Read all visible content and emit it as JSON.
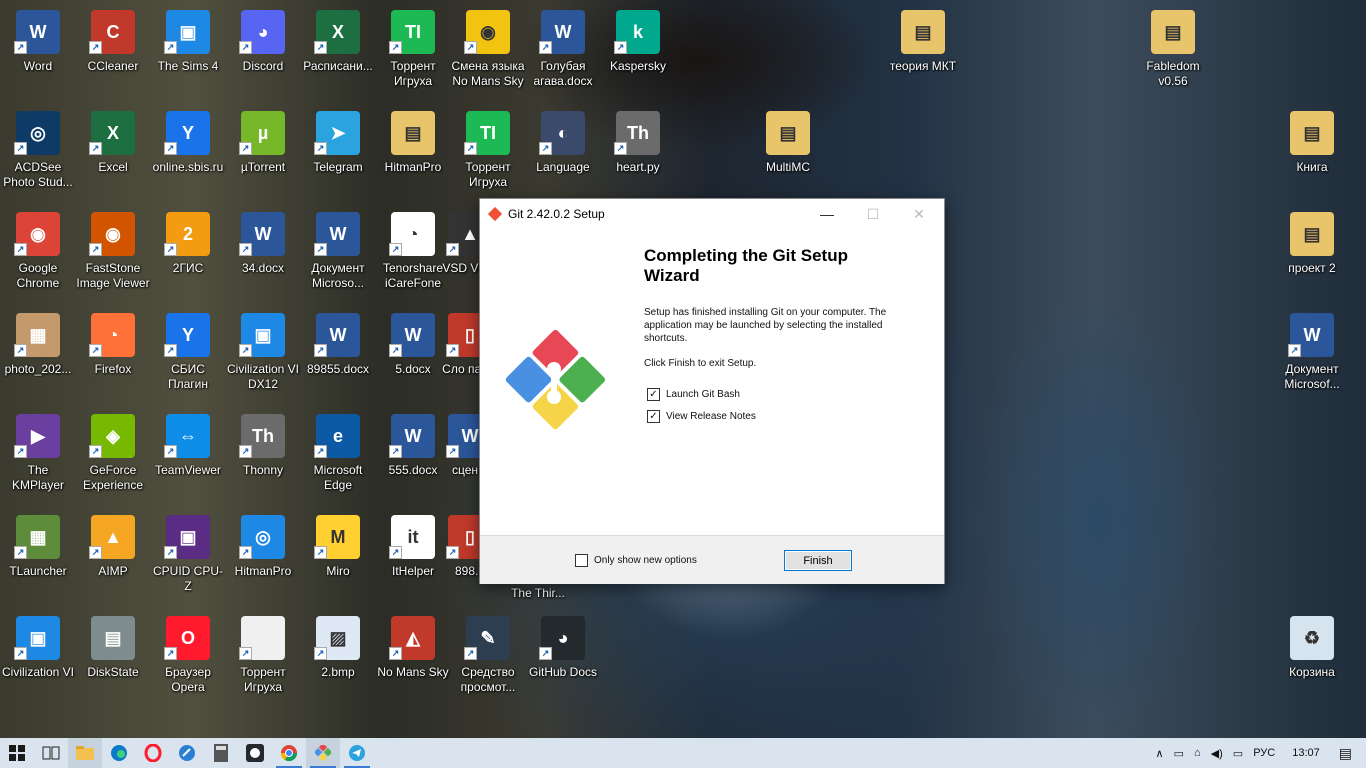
{
  "desktop_icons": [
    {
      "label": "Word",
      "color": "#2b579a",
      "glyph": "W"
    },
    {
      "label": "CCleaner",
      "color": "#c0392b",
      "glyph": "C"
    },
    {
      "label": "The Sims 4",
      "color": "#1e88e5",
      "glyph": "▣"
    },
    {
      "label": "Discord",
      "color": "#5865f2",
      "glyph": "◕"
    },
    {
      "label": "Расписани...",
      "color": "#1d6f42",
      "glyph": "X"
    },
    {
      "label": "Торрент Игруха",
      "color": "#1db954",
      "glyph": "TI"
    },
    {
      "label": "Смена языка No Mans Sky",
      "color": "#f1c40f",
      "glyph": "◉"
    },
    {
      "label": "Голубая агава.docx",
      "color": "#2b579a",
      "glyph": "W"
    },
    {
      "label": "Kaspersky",
      "color": "#00a88e",
      "glyph": "k"
    },
    {
      "label": "теория МКТ",
      "color": "#e8c46a",
      "glyph": "▤"
    },
    {
      "label": "Fabledom v0.56",
      "color": "#e8c46a",
      "glyph": "▤"
    },
    {
      "label": "ACDSee Photo Stud...",
      "color": "#0d3b66",
      "glyph": "◎"
    },
    {
      "label": "Excel",
      "color": "#1d6f42",
      "glyph": "X"
    },
    {
      "label": "online.sbis.ru",
      "color": "#1a73e8",
      "glyph": "Y"
    },
    {
      "label": "µTorrent",
      "color": "#76b82a",
      "glyph": "µ"
    },
    {
      "label": "Telegram",
      "color": "#2aa3de",
      "glyph": "➤"
    },
    {
      "label": "HitmanPro",
      "color": "#e8c46a",
      "glyph": "▤"
    },
    {
      "label": "Торрент Игруха",
      "color": "#1db954",
      "glyph": "TI"
    },
    {
      "label": "Language",
      "color": "#3a4a6b",
      "glyph": "◐"
    },
    {
      "label": "heart.py",
      "color": "#6b6b6b",
      "glyph": "Th"
    },
    {
      "label": "MultiMC",
      "color": "#e8c46a",
      "glyph": "▤"
    },
    {
      "label": "Книга",
      "color": "#e8c46a",
      "glyph": "▤"
    },
    {
      "label": "Google Chrome",
      "color": "#db4437",
      "glyph": "◉"
    },
    {
      "label": "FastStone Image Viewer",
      "color": "#d35400",
      "glyph": "◉"
    },
    {
      "label": "2ГИС",
      "color": "#f39c12",
      "glyph": "2"
    },
    {
      "label": "34.docx",
      "color": "#2b579a",
      "glyph": "W"
    },
    {
      "label": "Документ Microso...",
      "color": "#2b579a",
      "glyph": "W"
    },
    {
      "label": "Tenorshare iCareFone",
      "color": "#ffffff",
      "glyph": "◔"
    },
    {
      "label": "VSD Vid...",
      "color": "#333333",
      "glyph": "▲"
    },
    {
      "label": "проект 2",
      "color": "#e8c46a",
      "glyph": "▤"
    },
    {
      "label": "photo_202...",
      "color": "#c49a6c",
      "glyph": "▦"
    },
    {
      "label": "Firefox",
      "color": "#ff7139",
      "glyph": "◔"
    },
    {
      "label": "СБИС Плагин",
      "color": "#1a73e8",
      "glyph": "Y"
    },
    {
      "label": "Civilization VI DX12",
      "color": "#1e88e5",
      "glyph": "▣"
    },
    {
      "label": "89855.docx",
      "color": "#2b579a",
      "glyph": "W"
    },
    {
      "label": "5.docx",
      "color": "#2b579a",
      "glyph": "W"
    },
    {
      "label": "Сло пар...",
      "color": "#c0392b",
      "glyph": "▯"
    },
    {
      "label": "Документ Microsof...",
      "color": "#2b579a",
      "glyph": "W"
    },
    {
      "label": "The KMPlayer",
      "color": "#6a3fa0",
      "glyph": "▶"
    },
    {
      "label": "GeForce Experience",
      "color": "#76b900",
      "glyph": "◈"
    },
    {
      "label": "TeamViewer",
      "color": "#0e8ee9",
      "glyph": "⇔"
    },
    {
      "label": "Thonny",
      "color": "#6b6b6b",
      "glyph": "Th"
    },
    {
      "label": "Microsoft Edge",
      "color": "#0c59a4",
      "glyph": "e"
    },
    {
      "label": "555.docx",
      "color": "#2b579a",
      "glyph": "W"
    },
    {
      "label": "сцен...",
      "color": "#2b579a",
      "glyph": "W"
    },
    {
      "label": "TLauncher",
      "color": "#5d8c3a",
      "glyph": "▦"
    },
    {
      "label": "AIMP",
      "color": "#f5a623",
      "glyph": "▲"
    },
    {
      "label": "CPUID CPU-Z",
      "color": "#5b2c83",
      "glyph": "▣"
    },
    {
      "label": "HitmanPro",
      "color": "#1e88e5",
      "glyph": "◎"
    },
    {
      "label": "Miro",
      "color": "#ffd02f",
      "glyph": "M"
    },
    {
      "label": "ItHelper",
      "color": "#ffffff",
      "glyph": "it"
    },
    {
      "label": "898...",
      "color": "#c0392b",
      "glyph": "▯"
    },
    {
      "label": "Civilization VI",
      "color": "#1e88e5",
      "glyph": "▣"
    },
    {
      "label": "DiskState",
      "color": "#7f8c8d",
      "glyph": "▤"
    },
    {
      "label": "Браузер Opera",
      "color": "#ff1b2d",
      "glyph": "O"
    },
    {
      "label": "Торрент Игруха",
      "color": "#f0f0f0",
      "glyph": ""
    },
    {
      "label": "2.bmp",
      "color": "#dfe9f5",
      "glyph": "▨"
    },
    {
      "label": "No Mans Sky",
      "color": "#c0392b",
      "glyph": "◭"
    },
    {
      "label": "Средство просмот...",
      "color": "#2c3e50",
      "glyph": "✎"
    },
    {
      "label": "GitHub Docs",
      "color": "#24292e",
      "glyph": "◕"
    },
    {
      "label": "The Thir...",
      "color": "#2c3e50",
      "glyph": ""
    },
    {
      "label": "Корзина",
      "color": "#d6e4f0",
      "glyph": "♻"
    }
  ],
  "dialog": {
    "title": "Git 2.42.0.2 Setup",
    "minimize": "—",
    "maximize": "☐",
    "close": "✕",
    "heading": "Completing the Git Setup Wizard",
    "body": "Setup has finished installing Git on your computer. The application may be launched by selecting the installed shortcuts.",
    "finish_hint": "Click Finish to exit Setup.",
    "options": [
      {
        "label": "Launch Git Bash",
        "checked": true
      },
      {
        "label": "View Release Notes",
        "checked": true
      }
    ],
    "only_new_label": "Only show new options",
    "only_new_checked": false,
    "finish_button": "Finish"
  },
  "taskbar": {
    "items": [
      "start",
      "task-view",
      "file-explorer",
      "edge",
      "opera",
      "browser",
      "calculator",
      "github",
      "chrome",
      "git-setup",
      "telegram"
    ],
    "tray_language": "РУС",
    "time": "13:07"
  }
}
